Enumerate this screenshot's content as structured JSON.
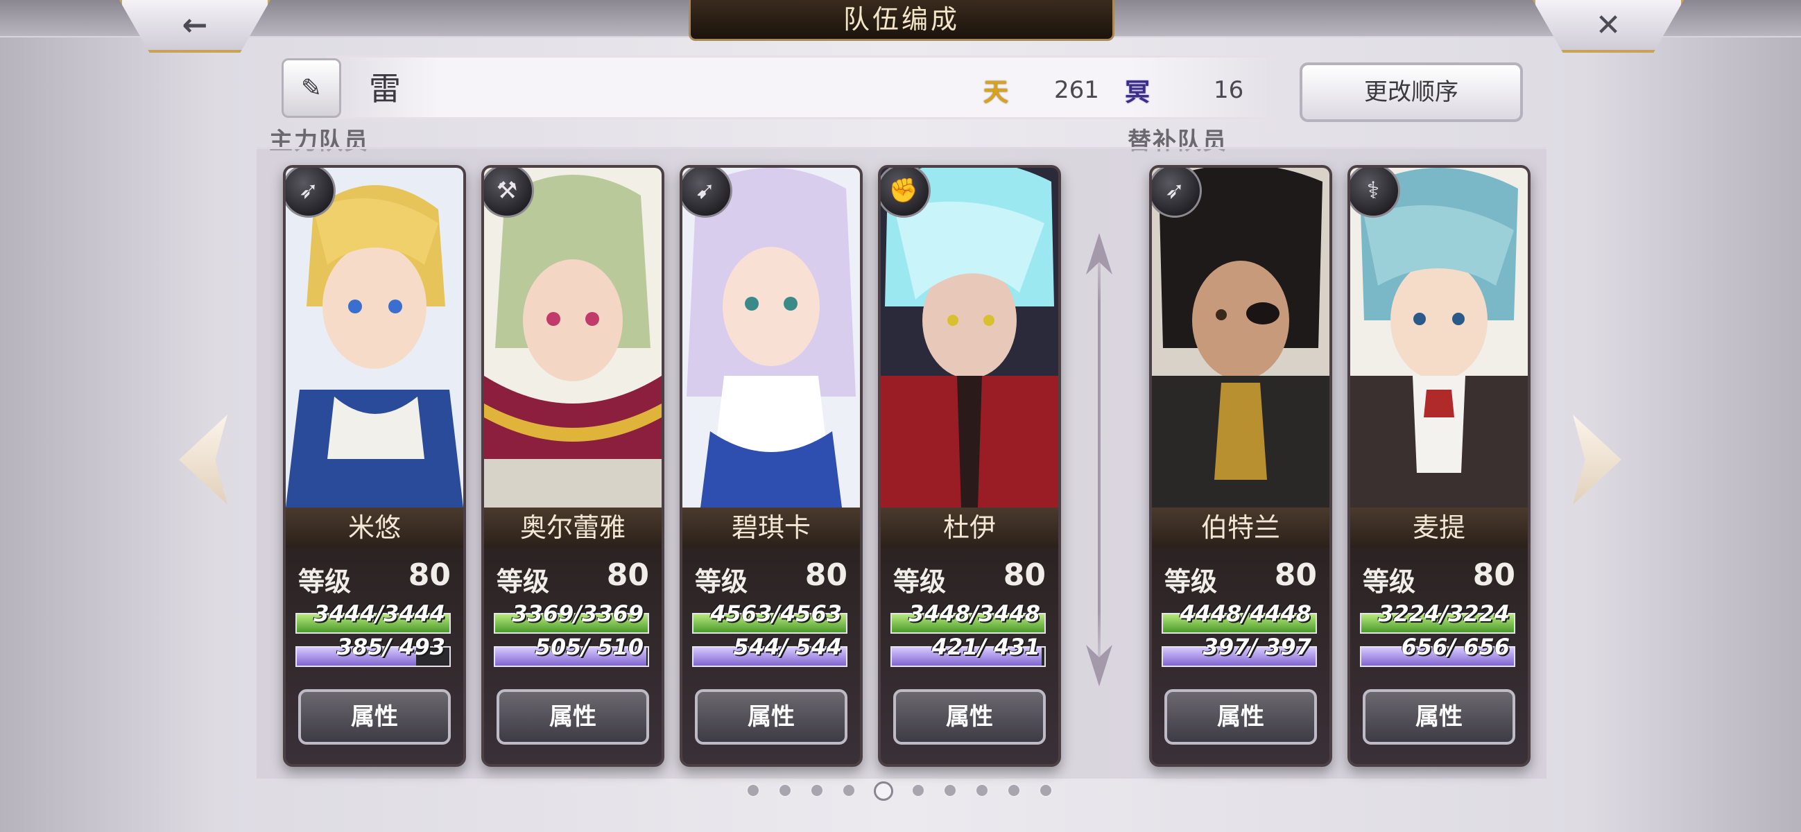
{
  "header": {
    "title": "队伍编成",
    "back_icon": "←",
    "close_icon": "✕"
  },
  "team": {
    "edit_icon": "✎",
    "name": "雷",
    "badge1_icon": "天",
    "badge1_value": "261",
    "badge2_icon": "冥",
    "badge2_value": "16",
    "reorder_label": "更改顺序"
  },
  "sections": {
    "main_label": "主力队员",
    "sub_label": "替补队员"
  },
  "characters": [
    {
      "name": "米悠",
      "weapon_icon": "➶",
      "level_label": "等级",
      "level": "80",
      "hp_text": "3444/3444",
      "hp_fraction": 1.0,
      "mp_text": "385/ 493",
      "mp_fraction": 0.78,
      "attr_label": "属性"
    },
    {
      "name": "奥尔蕾雅",
      "weapon_icon": "⚒",
      "level_label": "等级",
      "level": "80",
      "hp_text": "3369/3369",
      "hp_fraction": 1.0,
      "mp_text": "505/ 510",
      "mp_fraction": 0.99,
      "attr_label": "属性"
    },
    {
      "name": "碧琪卡",
      "weapon_icon": "➹",
      "level_label": "等级",
      "level": "80",
      "hp_text": "4563/4563",
      "hp_fraction": 1.0,
      "mp_text": "544/ 544",
      "mp_fraction": 1.0,
      "attr_label": "属性"
    },
    {
      "name": "杜伊",
      "weapon_icon": "✊",
      "level_label": "等级",
      "level": "80",
      "hp_text": "3448/3448",
      "hp_fraction": 1.0,
      "mp_text": "421/ 431",
      "mp_fraction": 0.98,
      "attr_label": "属性"
    },
    {
      "name": "伯特兰",
      "weapon_icon": "➶",
      "level_label": "等级",
      "level": "80",
      "hp_text": "4448/4448",
      "hp_fraction": 1.0,
      "mp_text": "397/ 397",
      "mp_fraction": 1.0,
      "attr_label": "属性"
    },
    {
      "name": "麦提",
      "weapon_icon": "⚕",
      "level_label": "等级",
      "level": "80",
      "hp_text": "3224/3224",
      "hp_fraction": 1.0,
      "mp_text": "656/ 656",
      "mp_fraction": 1.0,
      "attr_label": "属性"
    }
  ],
  "pagination": {
    "pages": 10,
    "active": 5
  },
  "colors": {
    "hp": "#4c9a2c",
    "mp": "#8166cf",
    "gold": "#d9a21c"
  }
}
